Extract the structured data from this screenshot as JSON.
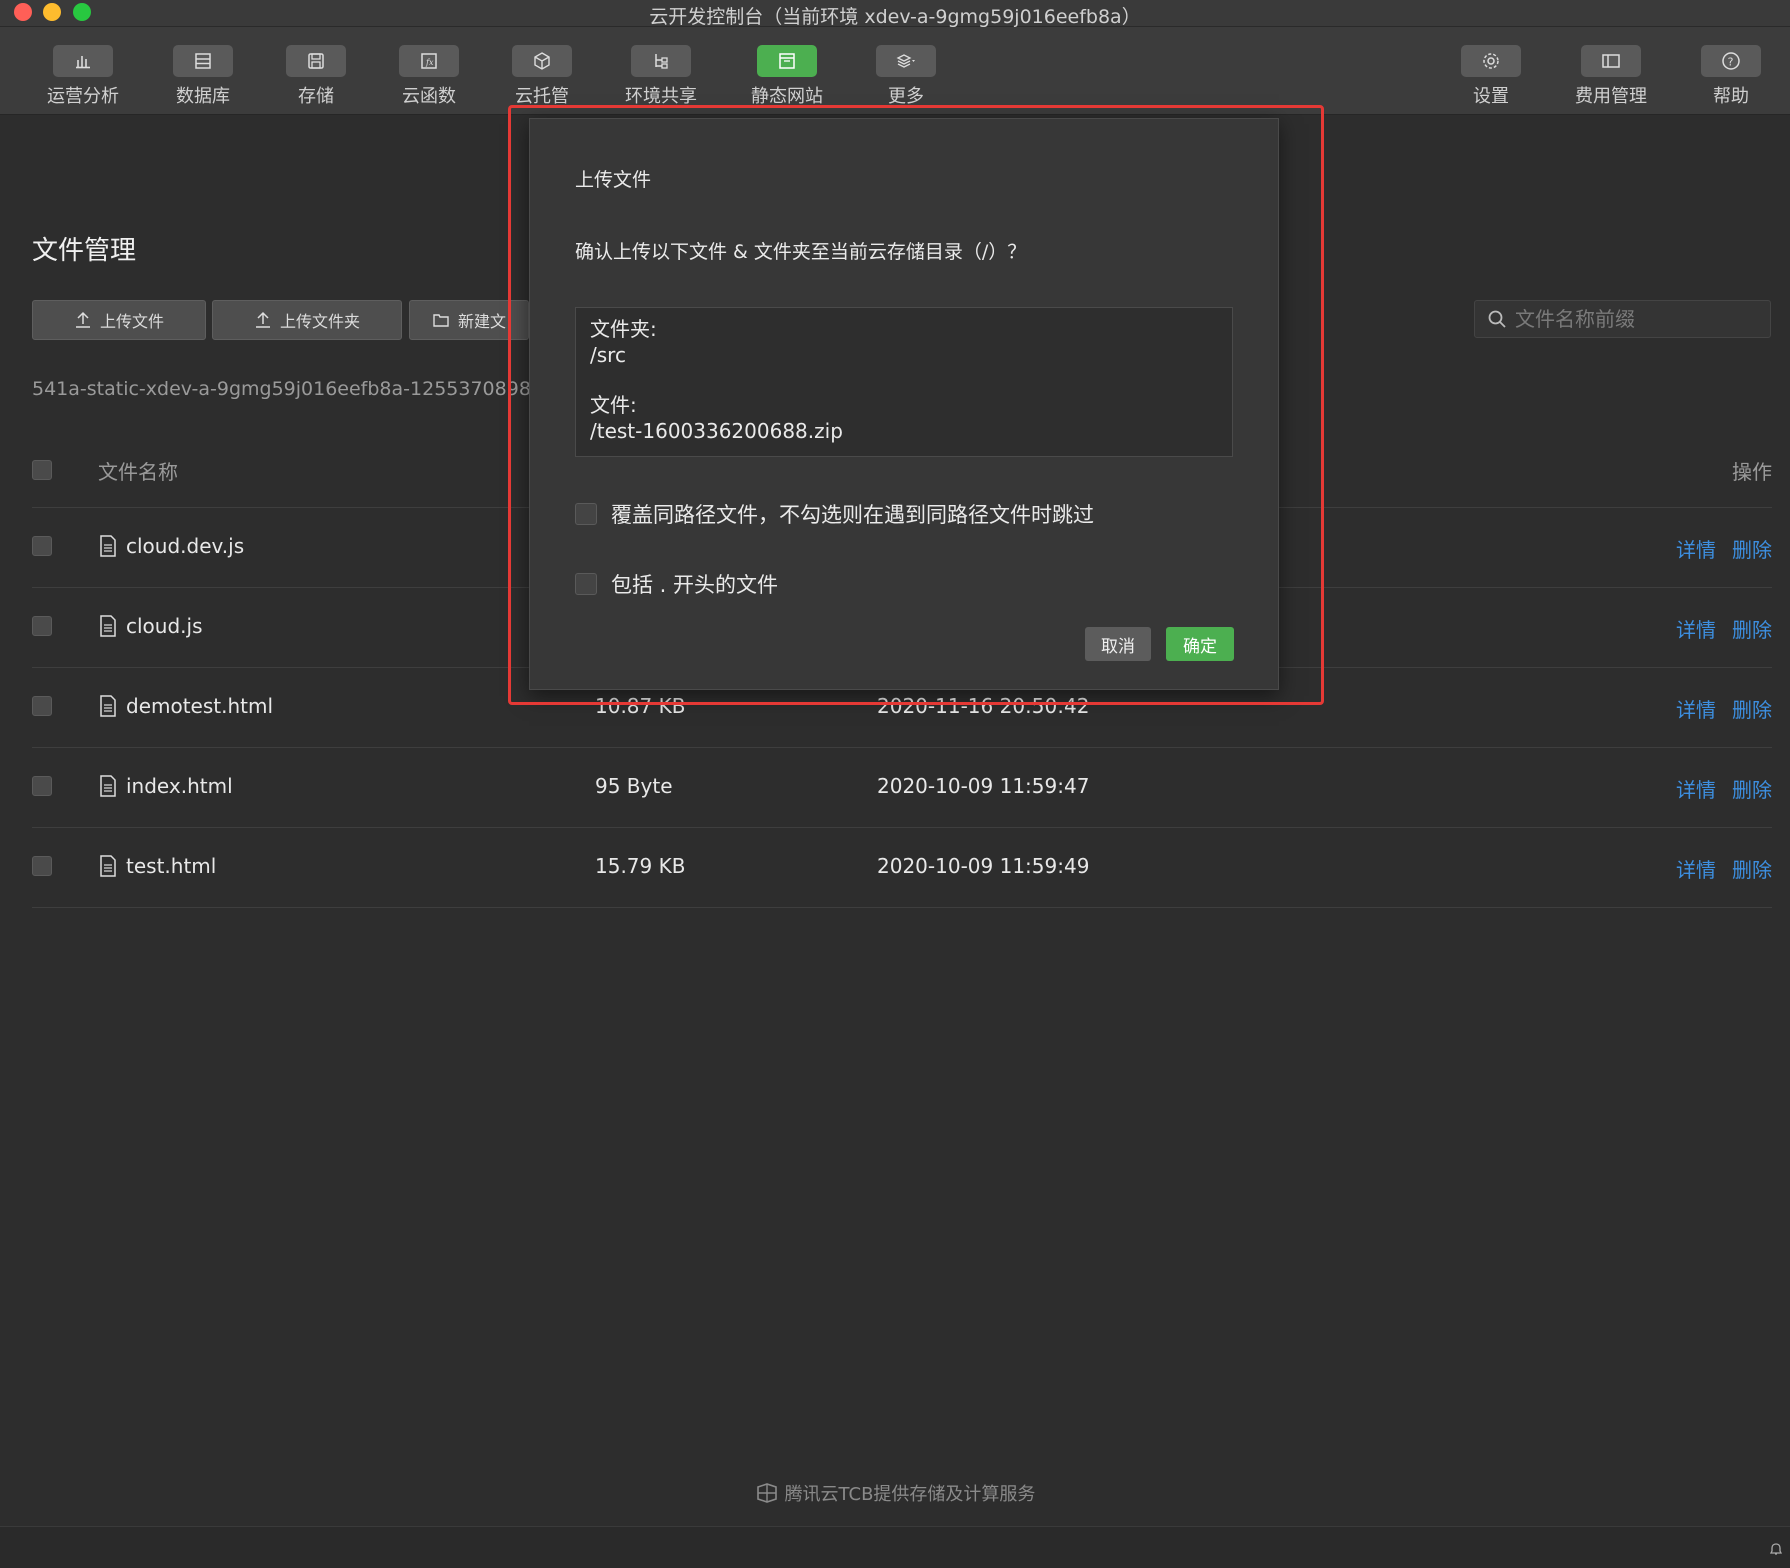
{
  "window": {
    "title": "云开发控制台（当前环境 xdev-a-9gmg59j016eefb8a）"
  },
  "toolbar": {
    "items": [
      {
        "label": "运营分析",
        "icon": "bar-chart-icon"
      },
      {
        "label": "数据库",
        "icon": "database-icon"
      },
      {
        "label": "存储",
        "icon": "save-icon"
      },
      {
        "label": "云函数",
        "icon": "function-icon"
      },
      {
        "label": "云托管",
        "icon": "cube-icon"
      },
      {
        "label": "环境共享",
        "icon": "tree-icon"
      },
      {
        "label": "静态网站",
        "icon": "website-icon",
        "active": true
      },
      {
        "label": "更多",
        "icon": "layers-icon"
      },
      {
        "label": "设置",
        "icon": "gear-icon"
      },
      {
        "label": "费用管理",
        "icon": "billing-icon"
      },
      {
        "label": "帮助",
        "icon": "help-icon"
      }
    ]
  },
  "page": {
    "title": "文件管理",
    "upload_file": "上传文件",
    "upload_folder": "上传文件夹",
    "new_folder": "新建文",
    "search_placeholder": "文件名称前缀",
    "bucket_path": "541a-static-xdev-a-9gmg59j016eefb8a-1255370898"
  },
  "table": {
    "header_name": "文件名称",
    "header_ops": "操作",
    "rows": [
      {
        "name": "cloud.dev.js",
        "size": "",
        "date": ""
      },
      {
        "name": "cloud.js",
        "size": "",
        "date": ""
      },
      {
        "name": "demotest.html",
        "size": "10.87 KB",
        "date": "2020-11-16 20:50:42"
      },
      {
        "name": "index.html",
        "size": "95 Byte",
        "date": "2020-10-09 11:59:47"
      },
      {
        "name": "test.html",
        "size": "15.79 KB",
        "date": "2020-10-09 11:59:49"
      }
    ],
    "detail_label": "详情",
    "delete_label": "删除"
  },
  "modal": {
    "title": "上传文件",
    "message": "确认上传以下文件 & 文件夹至当前云存储目录（/）？",
    "folder_label": "文件夹:",
    "folder_path": "/src",
    "file_label": "文件:",
    "file_path": "/test-1600336200688.zip",
    "option_overwrite": "覆盖同路径文件，不勾选则在遇到同路径文件时跳过",
    "option_dotfiles": "包括 . 开头的文件",
    "cancel": "取消",
    "confirm": "确定"
  },
  "footer": {
    "text": "腾讯云TCB提供存储及计算服务"
  },
  "colors": {
    "accent": "#4caf50",
    "link": "#3d8fe0",
    "highlight": "#e53935"
  }
}
